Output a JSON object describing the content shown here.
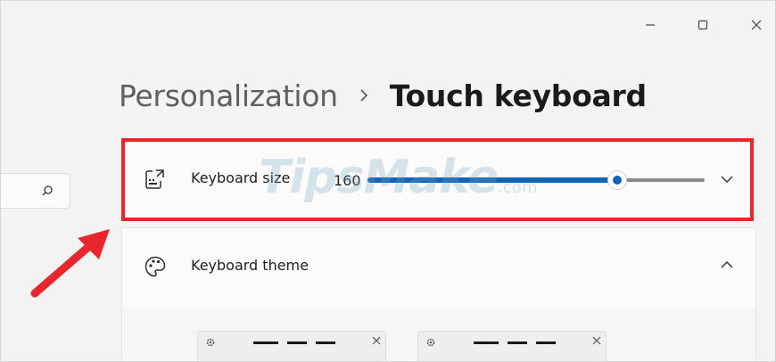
{
  "window": {
    "minimize_icon": "minimize-icon",
    "maximize_icon": "maximize-icon",
    "close_icon": "close-icon"
  },
  "breadcrumb": {
    "parent": "Personalization",
    "separator_icon": "chevron-right-icon",
    "current": "Touch keyboard"
  },
  "search": {
    "icon": "search-icon"
  },
  "keyboard_size": {
    "icon": "keyboard-resize-icon",
    "label": "Keyboard size",
    "value": "160",
    "slider_fraction": 0.74,
    "expand_icon": "chevron-down-icon"
  },
  "keyboard_theme": {
    "icon": "palette-icon",
    "label": "Keyboard theme",
    "collapse_icon": "chevron-up-icon"
  },
  "watermark": {
    "brand": "TipsMake",
    "suffix": ".com"
  },
  "colors": {
    "accent": "#0f63b8",
    "highlight": "#e8262c",
    "background": "#f3f3f3",
    "card": "#fbfbfb"
  }
}
